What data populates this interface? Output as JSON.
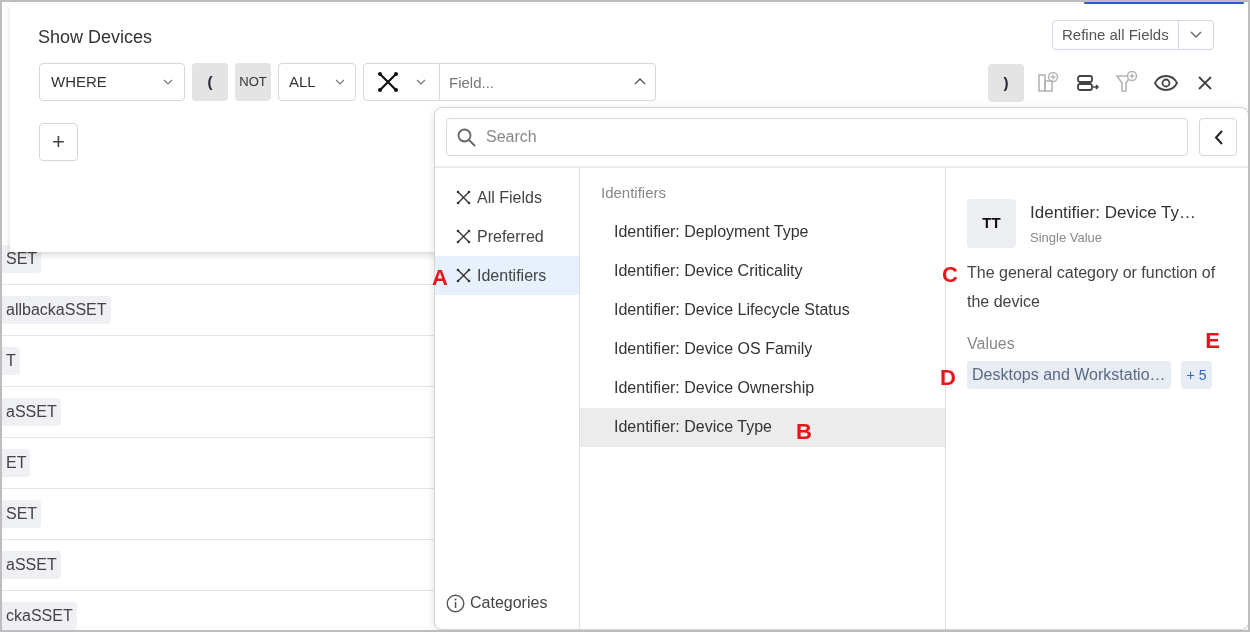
{
  "title": "Show Devices",
  "refine_button": {
    "label": "Refine all Fields"
  },
  "filter_row": {
    "conjunction": "WHERE",
    "open_paren": "(",
    "not": "NOT",
    "quantifier": "ALL",
    "field_placeholder": "Field...",
    "close_paren": ")"
  },
  "toolbar": [
    {
      "kind": "add-column",
      "disabled": true
    },
    {
      "kind": "group-rows",
      "disabled": false
    },
    {
      "kind": "add-filter",
      "disabled": true
    },
    {
      "kind": "view",
      "disabled": false
    },
    {
      "kind": "close",
      "disabled": false
    }
  ],
  "add_button": "+",
  "background_rows": [
    {
      "chip": "SET"
    },
    {
      "chip": "allbackaSSET"
    },
    {
      "chip": "T"
    },
    {
      "chip": "aSSET"
    },
    {
      "chip": "ET"
    },
    {
      "chip": "SET"
    },
    {
      "chip": "aSSET"
    },
    {
      "chip": "ckaSSET"
    }
  ],
  "field_picker": {
    "search_placeholder": "Search",
    "categories": [
      {
        "label": "All Fields",
        "selected": false
      },
      {
        "label": "Preferred",
        "selected": false
      },
      {
        "label": "Identifiers",
        "selected": true,
        "annotation": "A"
      }
    ],
    "categories_link": "Categories",
    "group_heading": "Identifiers",
    "fields": [
      {
        "label": "Identifier: Deployment Type",
        "selected": false
      },
      {
        "label": "Identifier: Device Criticality",
        "selected": false
      },
      {
        "label": "Identifier: Device Lifecycle Status",
        "selected": false
      },
      {
        "label": "Identifier: Device OS Family",
        "selected": false
      },
      {
        "label": "Identifier: Device Ownership",
        "selected": false
      },
      {
        "label": "Identifier: Device Type",
        "selected": true,
        "annotation": "B"
      }
    ],
    "detail": {
      "type_badge": "TT",
      "title": "Identifier: Device Ty…",
      "subtitle": "Single Value",
      "description": "The general category or function of the device",
      "description_annotation": "C",
      "values_heading": "Values",
      "values_annotation": "D",
      "more_annotation": "E",
      "value_chip": "Desktops and Workstatio…",
      "more_values": "+ 5"
    }
  }
}
